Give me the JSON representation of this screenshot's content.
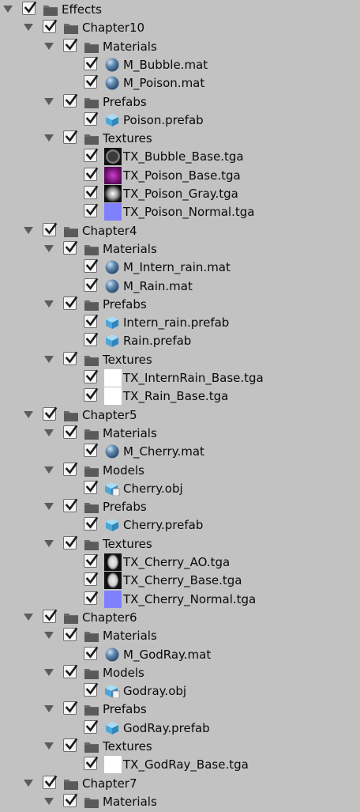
{
  "colors": {
    "background": "#c2c2c2",
    "check": "#1b1b1b",
    "folder": "#6a6a6a",
    "arrow": "#5c5c5c"
  },
  "tree": [
    {
      "level": 0,
      "type": "folder",
      "icon": "folder-icon",
      "label": "Effects",
      "expanded": true,
      "checked": true
    },
    {
      "level": 1,
      "type": "folder",
      "icon": "folder-icon",
      "label": "Chapter10",
      "expanded": true,
      "checked": true
    },
    {
      "level": 2,
      "type": "folder",
      "icon": "folder-icon",
      "label": "Materials",
      "expanded": true,
      "checked": true
    },
    {
      "level": 3,
      "type": "file",
      "icon": "material-sphere-icon",
      "label": "M_Bubble.mat",
      "checked": true
    },
    {
      "level": 3,
      "type": "file",
      "icon": "material-sphere-icon",
      "label": "M_Poison.mat",
      "checked": true
    },
    {
      "level": 2,
      "type": "folder",
      "icon": "folder-icon",
      "label": "Prefabs",
      "expanded": true,
      "checked": true
    },
    {
      "level": 3,
      "type": "file",
      "icon": "prefab-cube-icon",
      "label": "Poison.prefab",
      "checked": true
    },
    {
      "level": 2,
      "type": "folder",
      "icon": "folder-icon",
      "label": "Textures",
      "expanded": true,
      "checked": true
    },
    {
      "level": 3,
      "type": "file",
      "icon": "texture-bubble-thumbnail",
      "label": "TX_Bubble_Base.tga",
      "checked": true
    },
    {
      "level": 3,
      "type": "file",
      "icon": "texture-purple-thumbnail",
      "label": "TX_Poison_Base.tga",
      "checked": true
    },
    {
      "level": 3,
      "type": "file",
      "icon": "texture-gray-glow-thumbnail",
      "label": "TX_Poison_Gray.tga",
      "checked": true
    },
    {
      "level": 3,
      "type": "file",
      "icon": "texture-normal-thumbnail",
      "label": "TX_Poison_Normal.tga",
      "checked": true
    },
    {
      "level": 1,
      "type": "folder",
      "icon": "folder-icon",
      "label": "Chapter4",
      "expanded": true,
      "checked": true
    },
    {
      "level": 2,
      "type": "folder",
      "icon": "folder-icon",
      "label": "Materials",
      "expanded": true,
      "checked": true
    },
    {
      "level": 3,
      "type": "file",
      "icon": "material-sphere-icon",
      "label": "M_Intern_rain.mat",
      "checked": true
    },
    {
      "level": 3,
      "type": "file",
      "icon": "material-sphere-icon",
      "label": "M_Rain.mat",
      "checked": true
    },
    {
      "level": 2,
      "type": "folder",
      "icon": "folder-icon",
      "label": "Prefabs",
      "expanded": true,
      "checked": true
    },
    {
      "level": 3,
      "type": "file",
      "icon": "prefab-cube-icon",
      "label": "Intern_rain.prefab",
      "checked": true
    },
    {
      "level": 3,
      "type": "file",
      "icon": "prefab-cube-icon",
      "label": "Rain.prefab",
      "checked": true
    },
    {
      "level": 2,
      "type": "folder",
      "icon": "folder-icon",
      "label": "Textures",
      "expanded": true,
      "checked": true
    },
    {
      "level": 3,
      "type": "file",
      "icon": "texture-white-thumbnail",
      "label": "TX_InternRain_Base.tga",
      "checked": true
    },
    {
      "level": 3,
      "type": "file",
      "icon": "texture-white-thumbnail",
      "label": "TX_Rain_Base.tga",
      "checked": true
    },
    {
      "level": 1,
      "type": "folder",
      "icon": "folder-icon",
      "label": "Chapter5",
      "expanded": true,
      "checked": true
    },
    {
      "level": 2,
      "type": "folder",
      "icon": "folder-icon",
      "label": "Materials",
      "expanded": true,
      "checked": true
    },
    {
      "level": 3,
      "type": "file",
      "icon": "material-sphere-icon",
      "label": "M_Cherry.mat",
      "checked": true
    },
    {
      "level": 2,
      "type": "folder",
      "icon": "folder-icon",
      "label": "Models",
      "expanded": true,
      "checked": true
    },
    {
      "level": 3,
      "type": "file",
      "icon": "model-icon",
      "label": "Cherry.obj",
      "checked": true
    },
    {
      "level": 2,
      "type": "folder",
      "icon": "folder-icon",
      "label": "Prefabs",
      "expanded": true,
      "checked": true
    },
    {
      "level": 3,
      "type": "file",
      "icon": "prefab-cube-icon",
      "label": "Cherry.prefab",
      "checked": true
    },
    {
      "level": 2,
      "type": "folder",
      "icon": "folder-icon",
      "label": "Textures",
      "expanded": true,
      "checked": true
    },
    {
      "level": 3,
      "type": "file",
      "icon": "texture-ao-thumbnail",
      "label": "TX_Cherry_AO.tga",
      "checked": true
    },
    {
      "level": 3,
      "type": "file",
      "icon": "texture-ao-thumbnail",
      "label": "TX_Cherry_Base.tga",
      "checked": true
    },
    {
      "level": 3,
      "type": "file",
      "icon": "texture-normal-thumbnail",
      "label": "TX_Cherry_Normal.tga",
      "checked": true
    },
    {
      "level": 1,
      "type": "folder",
      "icon": "folder-icon",
      "label": "Chapter6",
      "expanded": true,
      "checked": true
    },
    {
      "level": 2,
      "type": "folder",
      "icon": "folder-icon",
      "label": "Materials",
      "expanded": true,
      "checked": true
    },
    {
      "level": 3,
      "type": "file",
      "icon": "material-sphere-icon",
      "label": "M_GodRay.mat",
      "checked": true
    },
    {
      "level": 2,
      "type": "folder",
      "icon": "folder-icon",
      "label": "Models",
      "expanded": true,
      "checked": true
    },
    {
      "level": 3,
      "type": "file",
      "icon": "model-icon",
      "label": "Godray.obj",
      "checked": true
    },
    {
      "level": 2,
      "type": "folder",
      "icon": "folder-icon",
      "label": "Prefabs",
      "expanded": true,
      "checked": true
    },
    {
      "level": 3,
      "type": "file",
      "icon": "prefab-cube-icon",
      "label": "GodRay.prefab",
      "checked": true
    },
    {
      "level": 2,
      "type": "folder",
      "icon": "folder-icon",
      "label": "Textures",
      "expanded": true,
      "checked": true
    },
    {
      "level": 3,
      "type": "file",
      "icon": "texture-white-thumbnail",
      "label": "TX_GodRay_Base.tga",
      "checked": true
    },
    {
      "level": 1,
      "type": "folder",
      "icon": "folder-icon",
      "label": "Chapter7",
      "expanded": true,
      "checked": true
    },
    {
      "level": 2,
      "type": "folder",
      "icon": "folder-icon",
      "label": "Materials",
      "expanded": true,
      "checked": true
    }
  ]
}
